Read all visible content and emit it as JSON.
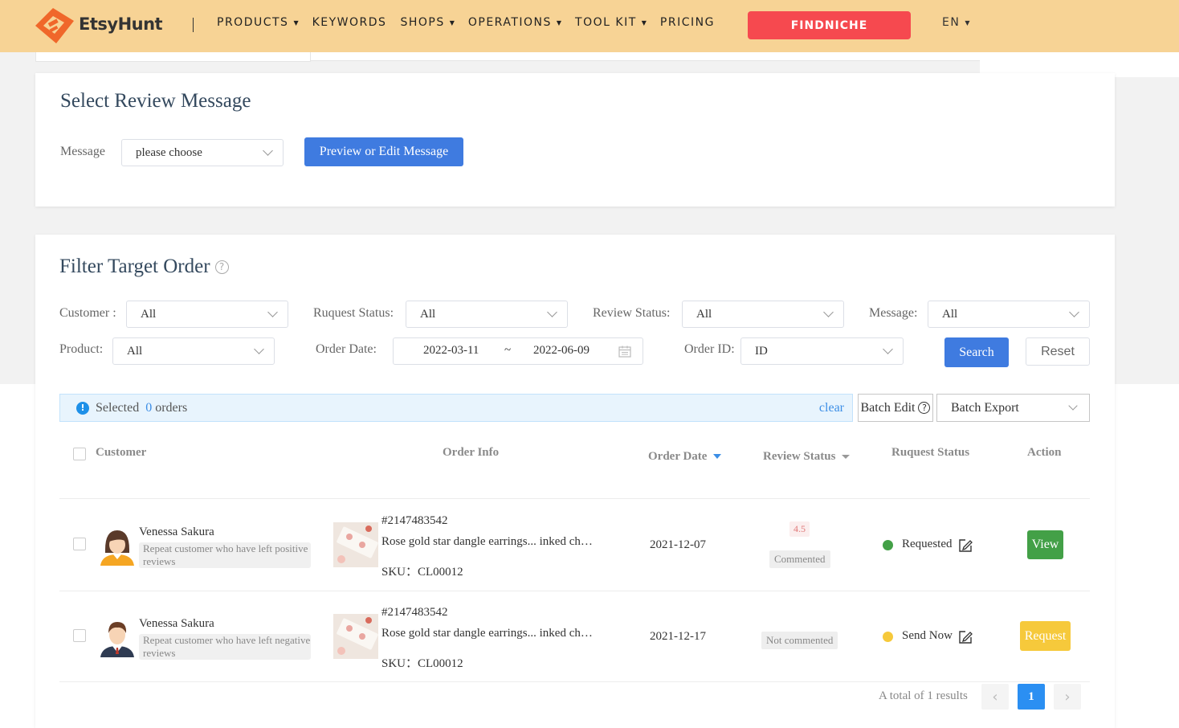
{
  "header": {
    "brand": "EtsyHunt",
    "nav": [
      {
        "label": "PRODUCTS",
        "dropdown": true
      },
      {
        "label": "KEYWORDS",
        "dropdown": false
      },
      {
        "label": "SHOPS",
        "dropdown": true
      },
      {
        "label": "OPERATIONS",
        "dropdown": true
      },
      {
        "label": "TOOL KIT",
        "dropdown": true
      },
      {
        "label": "PRICING",
        "dropdown": false
      }
    ],
    "findniche_label": "FINDNICHE",
    "lang_label": "EN",
    "colors": {
      "bar": "#f7d395",
      "findniche": "#f6494f",
      "logo": "#f0672a"
    }
  },
  "review_message": {
    "title": "Select Review Message",
    "message_label": "Message",
    "message_placeholder": "please choose",
    "preview_button": "Preview or Edit Message"
  },
  "filter": {
    "title": "Filter Target Order",
    "customer_label": "Customer :",
    "customer_value": "All",
    "request_status_label": "Ruquest Status:",
    "request_status_value": "All",
    "review_status_label": "Review Status:",
    "review_status_value": "All",
    "message_label": "Message:",
    "message_value": "All",
    "product_label": "Product:",
    "product_value": "All",
    "order_date_label": "Order Date:",
    "date_start": "2022-03-11",
    "date_sep": "~",
    "date_end": "2022-06-09",
    "order_id_label": "Order ID:",
    "order_id_value": "ID",
    "search_button": "Search",
    "reset_button": "Reset"
  },
  "selection": {
    "prefix": "Selected",
    "count": "0",
    "suffix": "orders",
    "clear": "clear",
    "batch_edit": "Batch Edit",
    "batch_export": "Batch Export"
  },
  "table": {
    "columns": {
      "customer": "Customer",
      "order_info": "Order Info",
      "order_date": "Order Date",
      "review_status": "Review Status",
      "request_status": "Ruquest Status",
      "action": "Action"
    },
    "rows": [
      {
        "customer_name": "Venessa Sakura",
        "customer_tag": "Repeat customer who have left positive reviews",
        "avatar": "female-avatar",
        "order_id": "#2147483542",
        "product_title": "Rose gold star dangle earrings... inked ch…",
        "sku": "SKU：CL00012",
        "order_date": "2021-12-07",
        "rating": "4.5",
        "review_status": "Commented",
        "request_status": "Requested",
        "status_color": "#43a047",
        "action": "View"
      },
      {
        "customer_name": "Venessa Sakura",
        "customer_tag": "Repeat customer who have left negative reviews",
        "avatar": "male-avatar",
        "order_id": "#2147483542",
        "product_title": "Rose gold star dangle earrings... inked ch…",
        "sku": "SKU：CL00012",
        "order_date": "2021-12-17",
        "rating": "",
        "review_status": "Not commented",
        "request_status": "Send Now",
        "status_color": "#f6c93b",
        "action": "Request"
      }
    ]
  },
  "pagination": {
    "total_text": "A total of 1 results",
    "current_page": "1"
  }
}
